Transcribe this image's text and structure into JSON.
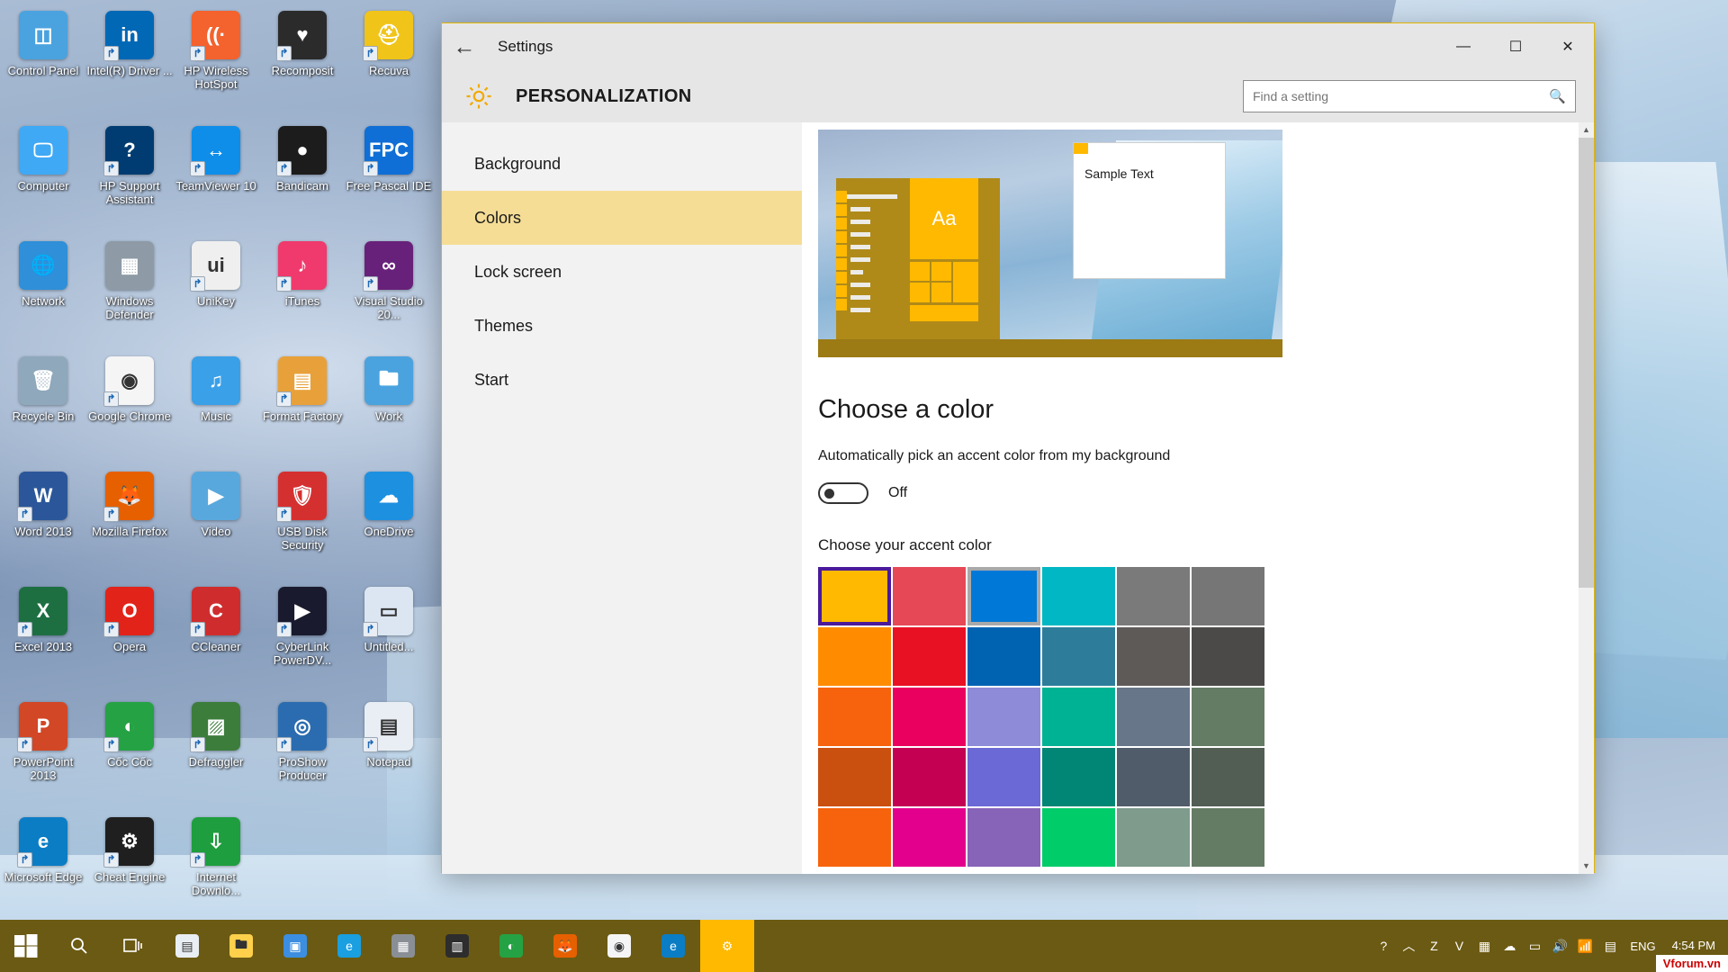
{
  "desktop": {
    "icons": [
      {
        "label": "Control Panel",
        "icon": "control-panel-icon",
        "bg": "#4aa3df",
        "glyph": "◫",
        "shortcut": false
      },
      {
        "label": "Intel(R) Driver ...",
        "icon": "intel-driver-icon",
        "bg": "#0068b5",
        "glyph": "in",
        "shortcut": true
      },
      {
        "label": "HP Wireless HotSpot",
        "icon": "hp-wireless-hotspot-icon",
        "bg": "#f4622d",
        "glyph": "((·",
        "shortcut": true
      },
      {
        "label": "Recomposit",
        "icon": "recomposit-icon",
        "bg": "#2b2b2b",
        "glyph": "♥",
        "shortcut": true
      },
      {
        "label": "Recuva",
        "icon": "recuva-icon",
        "bg": "#f0c419",
        "glyph": "⛑",
        "shortcut": true
      },
      {
        "label": "Computer",
        "icon": "computer-icon",
        "bg": "#3fa9f5",
        "glyph": "🖵",
        "shortcut": false
      },
      {
        "label": "HP Support Assistant",
        "icon": "hp-support-assistant-icon",
        "bg": "#003c71",
        "glyph": "?",
        "shortcut": true
      },
      {
        "label": "TeamViewer 10",
        "icon": "teamviewer-icon",
        "bg": "#0e8ee9",
        "glyph": "↔",
        "shortcut": true
      },
      {
        "label": "Bandicam",
        "icon": "bandicam-icon",
        "bg": "#1c1c1c",
        "glyph": "●",
        "shortcut": true
      },
      {
        "label": "Free Pascal IDE",
        "icon": "free-pascal-ide-icon",
        "bg": "#0f6fd6",
        "glyph": "FPC",
        "shortcut": true
      },
      {
        "label": "Network",
        "icon": "network-icon",
        "bg": "#2f8fd8",
        "glyph": "🌐",
        "shortcut": false
      },
      {
        "label": "Windows Defender",
        "icon": "windows-defender-icon",
        "bg": "#8e9aa6",
        "glyph": "▦",
        "shortcut": false
      },
      {
        "label": "UniKey",
        "icon": "unikey-icon",
        "bg": "#efefef",
        "glyph": "ui",
        "shortcut": true
      },
      {
        "label": "iTunes",
        "icon": "itunes-icon",
        "bg": "#f0396c",
        "glyph": "♪",
        "shortcut": true
      },
      {
        "label": "Visual Studio 20...",
        "icon": "visual-studio-icon",
        "bg": "#68217a",
        "glyph": "∞",
        "shortcut": true
      },
      {
        "label": "Recycle Bin",
        "icon": "recycle-bin-icon",
        "bg": "#8fa8bb",
        "glyph": "🗑",
        "shortcut": false
      },
      {
        "label": "Google Chrome",
        "icon": "google-chrome-icon",
        "bg": "#f5f5f5",
        "glyph": "◉",
        "shortcut": true
      },
      {
        "label": "Music",
        "icon": "music-folder-icon",
        "bg": "#3aa0e8",
        "glyph": "♫",
        "shortcut": false
      },
      {
        "label": "Format Factory",
        "icon": "format-factory-icon",
        "bg": "#e8a13a",
        "glyph": "▤",
        "shortcut": true
      },
      {
        "label": "Work",
        "icon": "work-folder-icon",
        "bg": "#4aa3df",
        "glyph": "🖿",
        "shortcut": false
      },
      {
        "label": "Word 2013",
        "icon": "word-2013-icon",
        "bg": "#2b579a",
        "glyph": "W",
        "shortcut": true
      },
      {
        "label": "Mozilla Firefox",
        "icon": "mozilla-firefox-icon",
        "bg": "#e66000",
        "glyph": "🦊",
        "shortcut": true
      },
      {
        "label": "Video",
        "icon": "video-folder-icon",
        "bg": "#59a8dd",
        "glyph": "▶",
        "shortcut": false
      },
      {
        "label": "USB Disk Security",
        "icon": "usb-disk-security-icon",
        "bg": "#d53030",
        "glyph": "🛡",
        "shortcut": true
      },
      {
        "label": "OneDrive",
        "icon": "onedrive-icon",
        "bg": "#1e90e0",
        "glyph": "☁",
        "shortcut": false
      },
      {
        "label": "Excel 2013",
        "icon": "excel-2013-icon",
        "bg": "#1d6f42",
        "glyph": "X",
        "shortcut": true
      },
      {
        "label": "Opera",
        "icon": "opera-icon",
        "bg": "#e2231a",
        "glyph": "O",
        "shortcut": true
      },
      {
        "label": "CCleaner",
        "icon": "ccleaner-icon",
        "bg": "#cf2d2d",
        "glyph": "C",
        "shortcut": true
      },
      {
        "label": "CyberLink PowerDV...",
        "icon": "cyberlink-powerdvd-icon",
        "bg": "#1a1a2e",
        "glyph": "▶",
        "shortcut": true
      },
      {
        "label": "Untitled...",
        "icon": "untitled-icon",
        "bg": "#dbe6f2",
        "glyph": "▭",
        "shortcut": true
      },
      {
        "label": "PowerPoint 2013",
        "icon": "powerpoint-2013-icon",
        "bg": "#d24726",
        "glyph": "P",
        "shortcut": true
      },
      {
        "label": "Cốc Cốc",
        "icon": "coc-coc-icon",
        "bg": "#25a244",
        "glyph": "◐",
        "shortcut": true
      },
      {
        "label": "Defraggler",
        "icon": "defraggler-icon",
        "bg": "#3c7d3c",
        "glyph": "▨",
        "shortcut": true
      },
      {
        "label": "ProShow Producer",
        "icon": "proshow-producer-icon",
        "bg": "#2b6cb0",
        "glyph": "◎",
        "shortcut": true
      },
      {
        "label": "Notepad",
        "icon": "notepad-icon",
        "bg": "#e9eef4",
        "glyph": "▤",
        "shortcut": true
      },
      {
        "label": "Microsoft Edge",
        "icon": "microsoft-edge-icon",
        "bg": "#0b7dc4",
        "glyph": "e",
        "shortcut": true
      },
      {
        "label": "Cheat Engine",
        "icon": "cheat-engine-icon",
        "bg": "#1f1f1f",
        "glyph": "⚙",
        "shortcut": true
      },
      {
        "label": "Internet Downlo...",
        "icon": "internet-download-manager-icon",
        "bg": "#1e9e3e",
        "glyph": "⇩",
        "shortcut": true
      }
    ]
  },
  "window": {
    "title": "Settings",
    "back_icon": "back-arrow-icon",
    "minimize_label": "—",
    "maximize_label": "☐",
    "close_label": "✕",
    "header": {
      "gear_icon": "gear-icon",
      "title": "PERSONALIZATION"
    },
    "search": {
      "placeholder": "Find a setting",
      "value": "",
      "icon": "search-icon"
    }
  },
  "sidebar": {
    "items": [
      {
        "label": "Background",
        "active": false
      },
      {
        "label": "Colors",
        "active": true
      },
      {
        "label": "Lock screen",
        "active": false
      },
      {
        "label": "Themes",
        "active": false
      },
      {
        "label": "Start",
        "active": false
      }
    ]
  },
  "preview": {
    "sample_window_text": "Sample Text",
    "tile_text": "Aa"
  },
  "main": {
    "heading": "Choose a color",
    "auto_accent_label": "Automatically pick an accent color from my background",
    "toggle_state": "Off",
    "accent_subhead": "Choose your accent color",
    "swatch_rows": [
      [
        {
          "color": "#ffb900",
          "state": "selected"
        },
        {
          "color": "#e74856",
          "state": "normal"
        },
        {
          "color": "#0078d7",
          "state": "hover"
        },
        {
          "color": "#00b7c3",
          "state": "normal"
        },
        {
          "color": "#7a7a7a",
          "state": "normal"
        },
        {
          "color": "#767676",
          "state": "normal"
        }
      ],
      [
        {
          "color": "#ff8c00",
          "state": "normal"
        },
        {
          "color": "#e81123",
          "state": "normal"
        },
        {
          "color": "#0063b1",
          "state": "normal"
        },
        {
          "color": "#2d7d9a",
          "state": "normal"
        },
        {
          "color": "#5d5a58",
          "state": "normal"
        },
        {
          "color": "#4c4a48",
          "state": "normal"
        }
      ],
      [
        {
          "color": "#f7630c",
          "state": "normal"
        },
        {
          "color": "#ea005e",
          "state": "normal"
        },
        {
          "color": "#8e8cd8",
          "state": "normal"
        },
        {
          "color": "#00b294",
          "state": "normal"
        },
        {
          "color": "#68768a",
          "state": "normal"
        },
        {
          "color": "#647c64",
          "state": "normal"
        }
      ],
      [
        {
          "color": "#ca5010",
          "state": "normal"
        },
        {
          "color": "#c30052",
          "state": "normal"
        },
        {
          "color": "#6b69d6",
          "state": "normal"
        },
        {
          "color": "#018574",
          "state": "normal"
        },
        {
          "color": "#515c6b",
          "state": "normal"
        },
        {
          "color": "#525e54",
          "state": "normal"
        }
      ],
      [
        {
          "color": "#f7630c",
          "state": "normal"
        },
        {
          "color": "#e3008c",
          "state": "normal"
        },
        {
          "color": "#8764b8",
          "state": "normal"
        },
        {
          "color": "#00cc6a",
          "state": "normal"
        },
        {
          "color": "#7e9b8c",
          "state": "normal"
        },
        {
          "color": "#647c64",
          "state": "normal"
        }
      ]
    ]
  },
  "annotation": {
    "arrow_color": "#e60000",
    "arrow_name": "red-arrow-pointing-at-toggle"
  },
  "taskbar": {
    "start_icon": "windows-start-icon",
    "search_icon": "search-icon",
    "taskview_icon": "task-view-icon",
    "buttons": [
      {
        "name": "notepad-taskbar-icon",
        "color": "#e9eef4",
        "glyph": "▤",
        "active": false
      },
      {
        "name": "file-explorer-taskbar-icon",
        "color": "#ffd04b",
        "glyph": "🖿",
        "active": false
      },
      {
        "name": "media-taskbar-icon",
        "color": "#3c8ee0",
        "glyph": "▣",
        "active": false
      },
      {
        "name": "ie-taskbar-icon",
        "color": "#1a9fe0",
        "glyph": "e",
        "active": false
      },
      {
        "name": "recorder-taskbar-icon",
        "color": "#8a8f96",
        "glyph": "▦",
        "active": false
      },
      {
        "name": "store-taskbar-icon",
        "color": "#2d2d2d",
        "glyph": "▥",
        "active": false
      },
      {
        "name": "coccoc-taskbar-icon",
        "color": "#25a244",
        "glyph": "◐",
        "active": false
      },
      {
        "name": "firefox-taskbar-icon",
        "color": "#e66000",
        "glyph": "🦊",
        "active": false
      },
      {
        "name": "chrome-taskbar-icon",
        "color": "#f5f5f5",
        "glyph": "◉",
        "active": false
      },
      {
        "name": "edge-taskbar-icon",
        "color": "#0b7dc4",
        "glyph": "e",
        "active": false
      },
      {
        "name": "settings-taskbar-icon",
        "color": "#ffb900",
        "glyph": "⚙",
        "active": true
      }
    ],
    "tray": [
      {
        "name": "help-tray-icon",
        "glyph": "?"
      },
      {
        "name": "show-hidden-icons-chevron",
        "glyph": "︿"
      },
      {
        "name": "zalo-tray-icon",
        "glyph": "Z"
      },
      {
        "name": "vforum-tray-icon",
        "glyph": "V"
      },
      {
        "name": "calendar-tray-icon",
        "glyph": "▦"
      },
      {
        "name": "onedrive-tray-icon",
        "glyph": "☁"
      },
      {
        "name": "battery-tray-icon",
        "glyph": "▭"
      },
      {
        "name": "volume-tray-icon",
        "glyph": "🔊"
      },
      {
        "name": "network-tray-icon",
        "glyph": "📶"
      },
      {
        "name": "action-center-icon",
        "glyph": "▤"
      }
    ],
    "language": "ENG",
    "time": "4:54 PM",
    "date": "",
    "watermark": "Vforum.vn"
  }
}
